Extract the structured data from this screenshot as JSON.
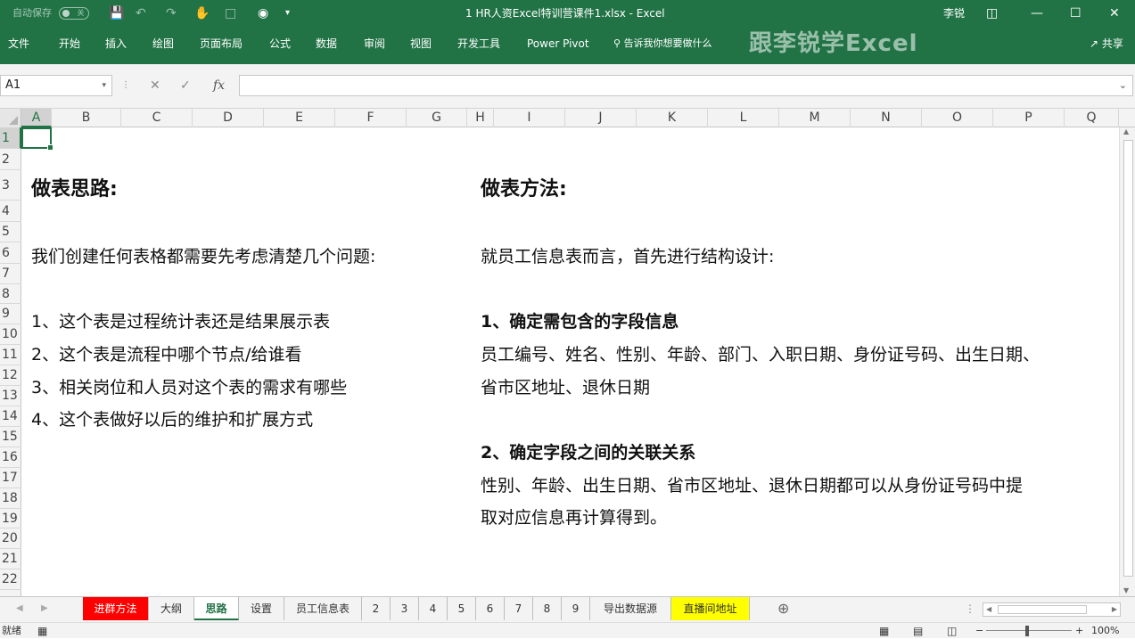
{
  "titlebar": {
    "autosave_label": "自动保存",
    "autosave_state": "关",
    "doc_title": "1 HR人资Excel特训营课件1.xlsx  -  Excel",
    "user": "李锐",
    "icons": [
      "save-icon",
      "undo-icon",
      "redo-icon",
      "touch-mode-icon",
      "shapes-icon",
      "camera-icon",
      "customize-qat-icon",
      "ribbon-display-icon",
      "minimize-icon",
      "maximize-icon",
      "close-icon"
    ]
  },
  "ribbon": {
    "tabs": [
      "文件",
      "开始",
      "插入",
      "绘图",
      "页面布局",
      "公式",
      "数据",
      "审阅",
      "视图",
      "开发工具",
      "Power Pivot"
    ],
    "tell_me": "告诉我你想要做什么",
    "brand": "跟李锐学Excel",
    "share": "共享"
  },
  "formula_bar": {
    "name_box": "A1",
    "formula": ""
  },
  "columns": [
    "A",
    "B",
    "C",
    "D",
    "E",
    "F",
    "G",
    "H",
    "I",
    "J",
    "K",
    "L",
    "M",
    "N",
    "O",
    "P",
    "Q"
  ],
  "rows": [
    "1",
    "2",
    "3",
    "4",
    "5",
    "6",
    "7",
    "8",
    "9",
    "10",
    "11",
    "12",
    "13",
    "14",
    "15",
    "16",
    "17",
    "18",
    "19",
    "20",
    "21",
    "22"
  ],
  "content": {
    "left_heading": "做表思路:",
    "left_intro": "我们创建任何表格都需要先考虑清楚几个问题:",
    "left_items": [
      "1、这个表是过程统计表还是结果展示表",
      "2、这个表是流程中哪个节点/给谁看",
      "3、相关岗位和人员对这个表的需求有哪些",
      "4、这个表做好以后的维护和扩展方式"
    ],
    "right_heading": "做表方法:",
    "right_intro": "就员工信息表而言，首先进行结构设计:",
    "right_s1_title": "1、确定需包含的字段信息",
    "right_s1_line1": "员工编号、姓名、性别、年龄、部门、入职日期、身份证号码、出生日期、",
    "right_s1_line2": "省市区地址、退休日期",
    "right_s2_title": "2、确定字段之间的关联关系",
    "right_s2_line1": "性别、年龄、出生日期、省市区地址、退休日期都可以从身份证号码中提",
    "right_s2_line2": "取对应信息再计算得到。"
  },
  "sheet_tabs": [
    {
      "label": "进群方法",
      "color": "#ff0000"
    },
    {
      "label": "大纲",
      "color": ""
    },
    {
      "label": "思路",
      "color": "",
      "active": true
    },
    {
      "label": "设置",
      "color": ""
    },
    {
      "label": "员工信息表",
      "color": ""
    },
    {
      "label": "2",
      "color": ""
    },
    {
      "label": "3",
      "color": ""
    },
    {
      "label": "4",
      "color": ""
    },
    {
      "label": "5",
      "color": ""
    },
    {
      "label": "6",
      "color": ""
    },
    {
      "label": "7",
      "color": ""
    },
    {
      "label": "8",
      "color": ""
    },
    {
      "label": "9",
      "color": ""
    },
    {
      "label": "导出数据源",
      "color": ""
    },
    {
      "label": "直播间地址",
      "color": "#ffff00"
    }
  ],
  "statusbar": {
    "ready": "就绪",
    "zoom": "100%"
  },
  "colors": {
    "accent": "#217346",
    "tab_red": "#ff0000",
    "tab_yellow": "#ffff00"
  }
}
